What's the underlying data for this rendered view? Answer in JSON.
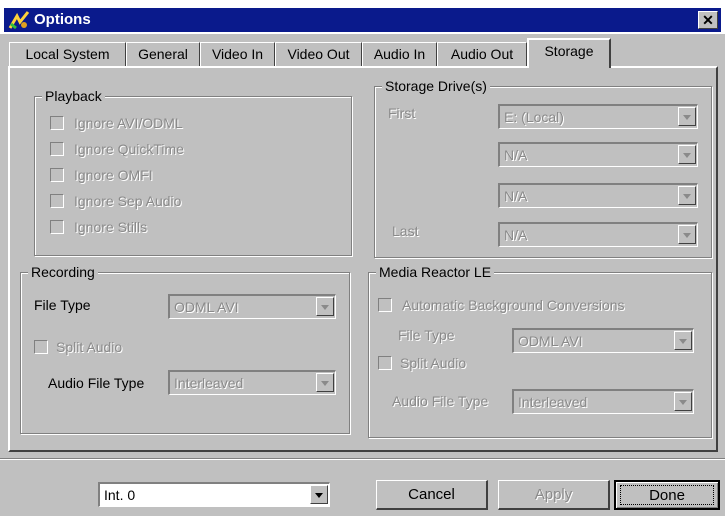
{
  "window": {
    "title": "Options",
    "close_glyph": "✕"
  },
  "tabs": [
    "Local System",
    "General",
    "Video In",
    "Video Out",
    "Audio In",
    "Audio Out",
    "Storage"
  ],
  "active_tab": "Storage",
  "playback": {
    "legend": "Playback",
    "items": [
      "Ignore AVI/ODML",
      "Ignore QuickTime",
      "Ignore OMFI",
      "Ignore Sep Audio",
      "Ignore Stills"
    ]
  },
  "storage": {
    "legend": "Storage Drive(s)",
    "first_label": "First",
    "last_label": "Last",
    "drives": [
      "E: (Local)",
      "N/A",
      "N/A",
      "N/A"
    ]
  },
  "recording": {
    "legend": "Recording",
    "file_type_label": "File Type",
    "file_type_value": "ODML AVI",
    "split_audio_label": "Split Audio",
    "audio_file_type_label": "Audio File Type",
    "audio_file_type_value": "Interleaved"
  },
  "media_reactor": {
    "legend": "Media Reactor LE",
    "auto_conv_label": "Automatic Background Conversions",
    "file_type_label": "File Type",
    "file_type_value": "ODML AVI",
    "split_audio_label": "Split Audio",
    "audio_file_type_label": "Audio File Type",
    "audio_file_type_value": "Interleaved"
  },
  "footer": {
    "channel_value": "Int. 0",
    "cancel_label": "Cancel",
    "apply_label": "Apply",
    "done_label": "Done"
  },
  "colors": {
    "titlebar": "#0a1a8c",
    "face": "#c0c0c0",
    "disabled_text": "#8a8a8a"
  },
  "icons": {
    "app": "app-icon",
    "close": "close-icon",
    "dropdown": "chevron-down-icon"
  }
}
